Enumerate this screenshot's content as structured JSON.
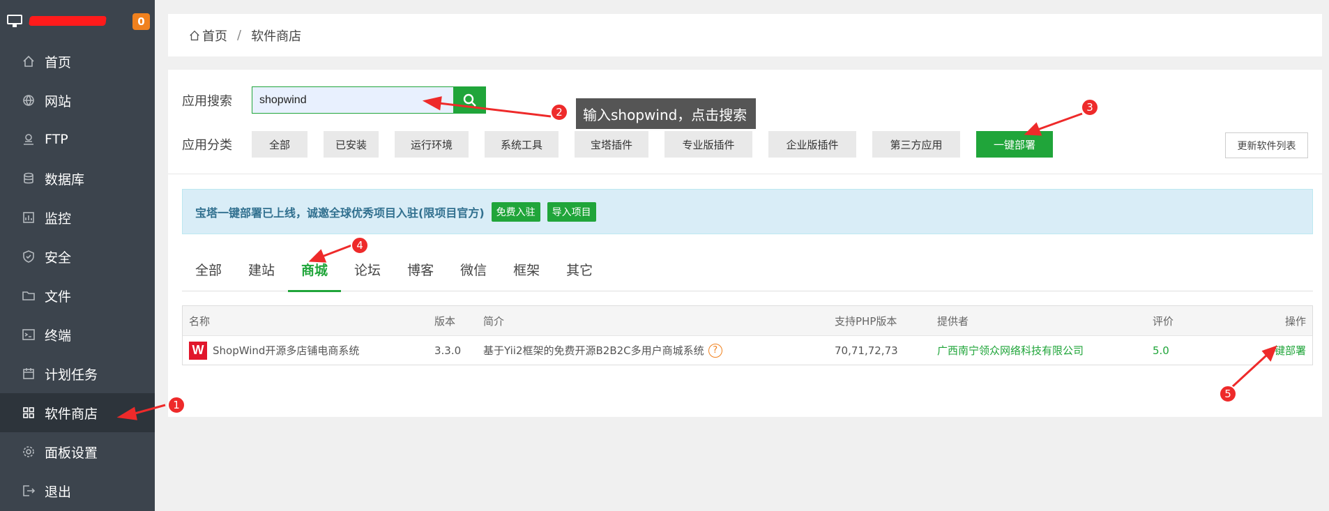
{
  "sidebar": {
    "badge": "0",
    "items": [
      {
        "label": "首页",
        "icon": "home-icon"
      },
      {
        "label": "网站",
        "icon": "globe-icon"
      },
      {
        "label": "FTP",
        "icon": "ftp-icon"
      },
      {
        "label": "数据库",
        "icon": "database-icon"
      },
      {
        "label": "监控",
        "icon": "monitor-chart-icon"
      },
      {
        "label": "安全",
        "icon": "shield-icon"
      },
      {
        "label": "文件",
        "icon": "folder-icon"
      },
      {
        "label": "终端",
        "icon": "terminal-icon"
      },
      {
        "label": "计划任务",
        "icon": "calendar-icon"
      },
      {
        "label": "软件商店",
        "icon": "grid-icon"
      },
      {
        "label": "面板设置",
        "icon": "gear-icon"
      },
      {
        "label": "退出",
        "icon": "logout-icon"
      }
    ]
  },
  "breadcrumb": {
    "home": "首页",
    "separator": "/",
    "current": "软件商店"
  },
  "search": {
    "label": "应用搜索",
    "value": "shopwind"
  },
  "categories": {
    "label": "应用分类",
    "items": [
      "全部",
      "已安装",
      "运行环境",
      "系统工具",
      "宝塔插件",
      "专业版插件",
      "企业版插件",
      "第三方应用",
      "一键部署"
    ],
    "update_label": "更新软件列表"
  },
  "notice": {
    "text": "宝塔一键部署已上线，诚邀全球优秀项目入驻(限项目官方)",
    "btn1": "免费入驻",
    "btn2": "导入项目"
  },
  "tabs": [
    "全部",
    "建站",
    "商城",
    "论坛",
    "博客",
    "微信",
    "框架",
    "其它"
  ],
  "table": {
    "headers": [
      "名称",
      "版本",
      "简介",
      "支持PHP版本",
      "提供者",
      "评价",
      "操作"
    ],
    "rows": [
      {
        "name": "ShopWind开源多店铺电商系统",
        "version": "3.3.0",
        "desc": "基于Yii2框架的免费开源B2B2C多用户商城系统",
        "php": "70,71,72,73",
        "provider": "广西南宁领众网络科技有限公司",
        "rating": "5.0",
        "action": "一键部署",
        "logo_letter": "W"
      }
    ]
  },
  "annotations": {
    "tooltip": "输入shopwind，点击搜索",
    "markers": [
      "1",
      "2",
      "3",
      "4",
      "5"
    ]
  },
  "colors": {
    "accent": "#20a53a",
    "sidebar": "#3c444d",
    "marker": "#ee2a2a",
    "badge": "#f0811e"
  }
}
